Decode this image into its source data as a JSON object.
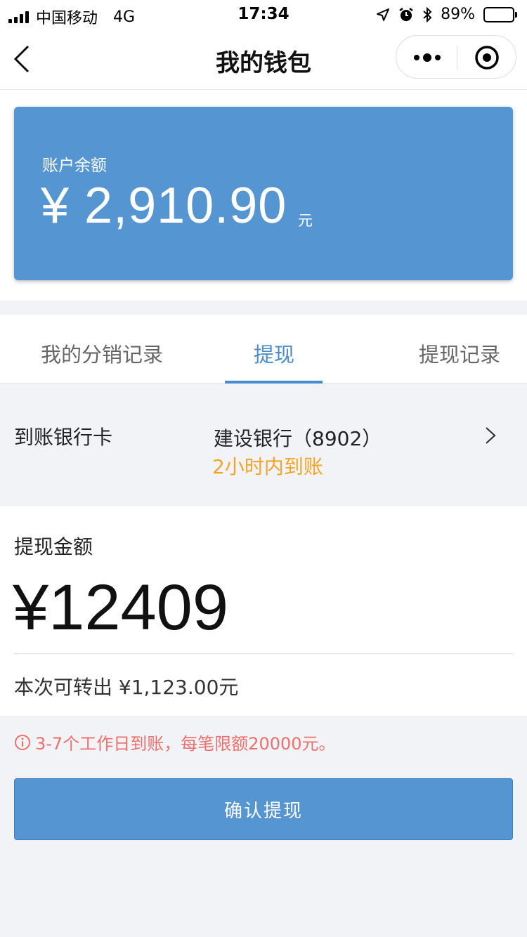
{
  "status_bar": {
    "carrier": "中国移动",
    "network": "4G",
    "time": "17:34",
    "battery": "89%",
    "battery_level": 0.89
  },
  "nav": {
    "title": "我的钱包"
  },
  "balance": {
    "label": "账户余额",
    "amount": "¥ 2,910.90",
    "unit": "元"
  },
  "tabs": [
    {
      "label": "我的分销记录",
      "active": false
    },
    {
      "label": "提现",
      "active": true
    },
    {
      "label": "提现记录",
      "active": false
    }
  ],
  "bank": {
    "label": "到账银行卡",
    "name": "建设银行（8902）",
    "eta": "2小时内到账"
  },
  "withdraw": {
    "label": "提现金额",
    "amount_value": "¥12409",
    "available": "本次可转出 ¥1,123.00元"
  },
  "notice": "3-7个工作日到账，每笔限额20000元。",
  "confirm_label": "确认提现",
  "colors": {
    "primary": "#5596d2",
    "tab_active": "#4a8bd0",
    "eta": "#f4a326",
    "notice": "#ef6f6c"
  }
}
